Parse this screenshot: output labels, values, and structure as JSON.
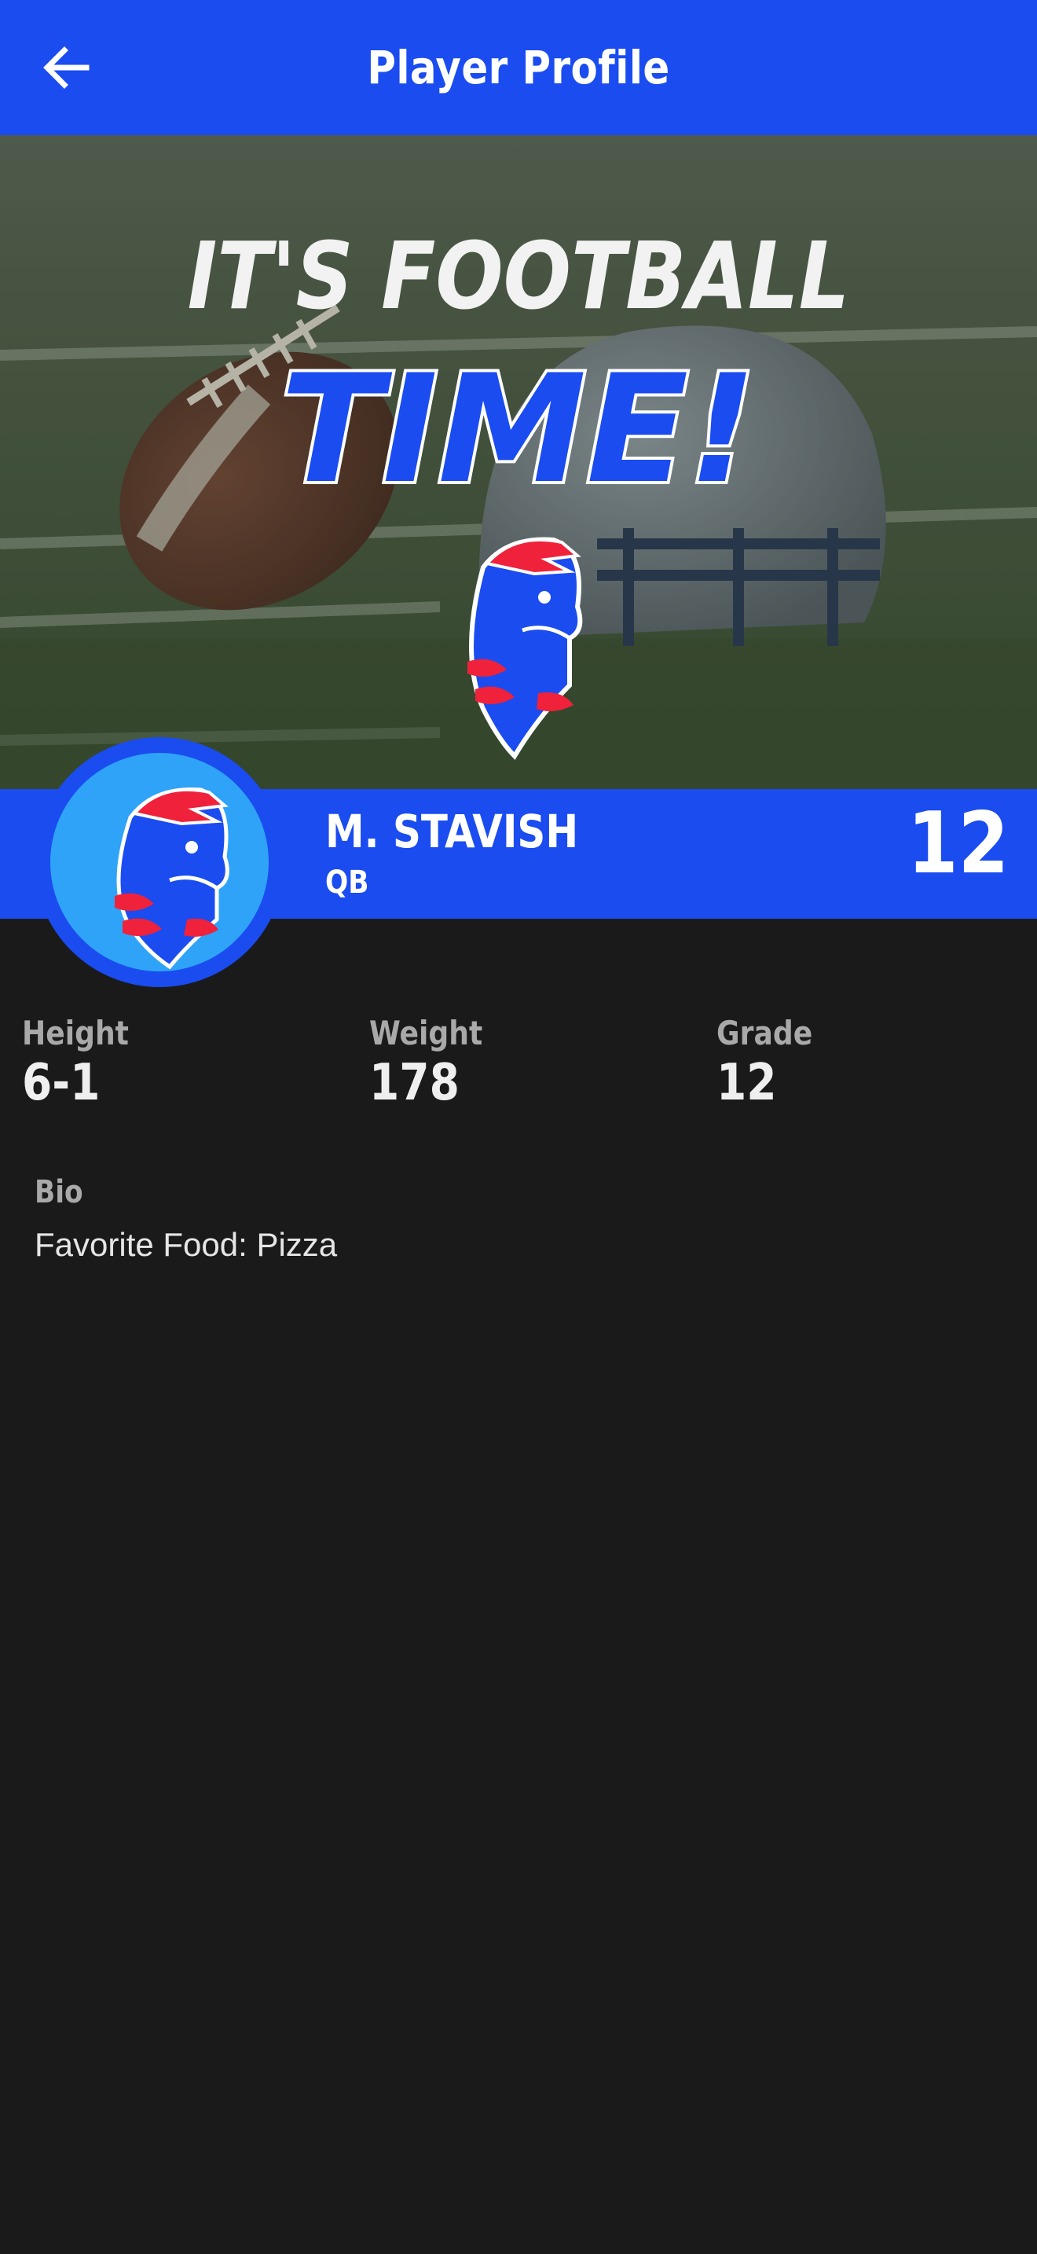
{
  "header": {
    "title": "Player Profile",
    "back_icon": "arrow-left-icon"
  },
  "hero": {
    "line1": "IT'S FOOTBALL",
    "line2": "TIME!",
    "mascot_icon": "warrior-head-logo"
  },
  "player": {
    "name": "M. STAVISH",
    "position": "QB",
    "number": "12",
    "avatar_icon": "warrior-head-logo"
  },
  "stats": [
    {
      "label": "Height",
      "value": "6-1"
    },
    {
      "label": "Weight",
      "value": "178"
    },
    {
      "label": "Grade",
      "value": "12"
    }
  ],
  "bio": {
    "label": "Bio",
    "text": "Favorite Food: Pizza"
  },
  "colors": {
    "primary": "#1a4cf0",
    "avatar_bg": "#2fa3f8",
    "background": "#1a1a1a",
    "mascot_red": "#f0213a",
    "label_gray": "#a9a9a9"
  }
}
